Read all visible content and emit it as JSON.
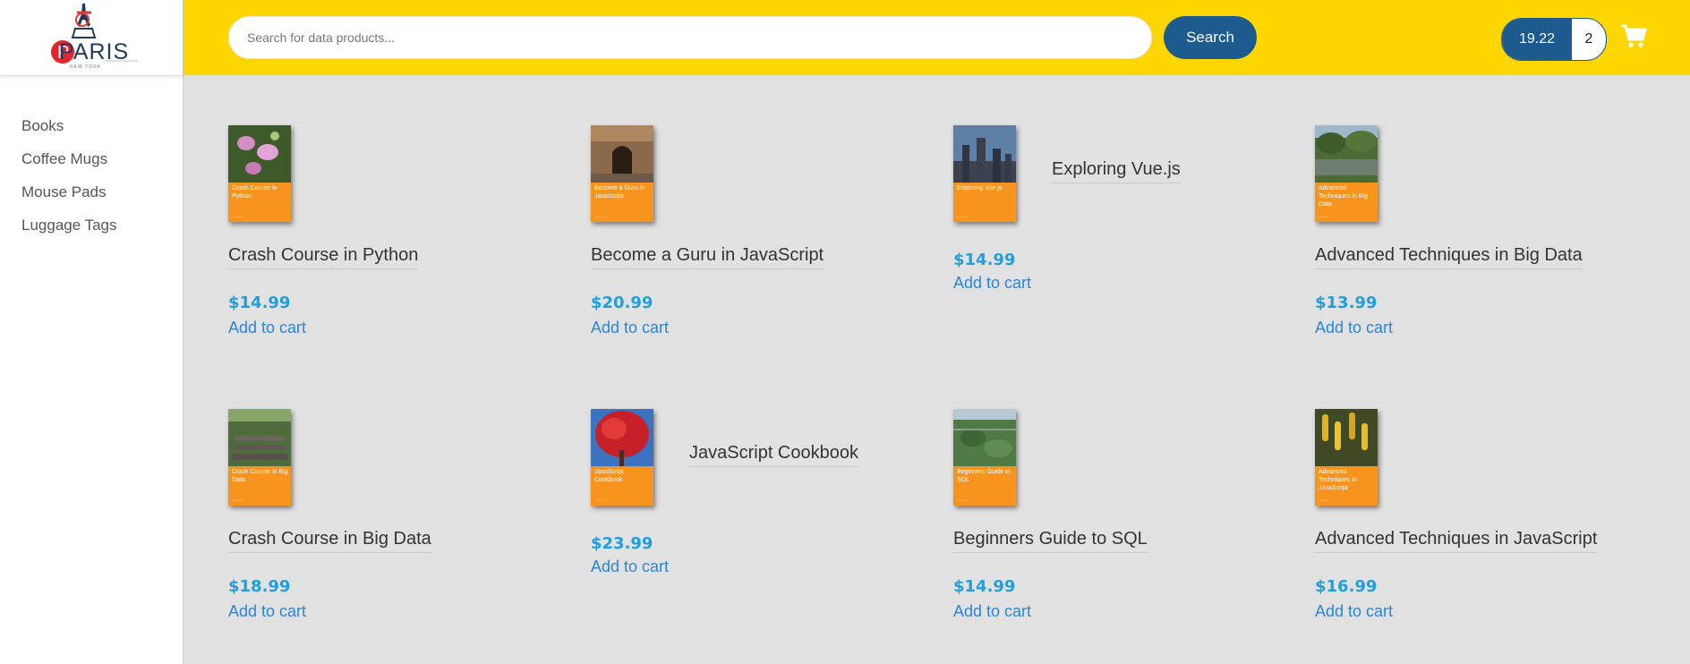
{
  "logo": {
    "brand": "PARIS",
    "tagline": "NEW YORK"
  },
  "sidebar": {
    "items": [
      {
        "label": "Books"
      },
      {
        "label": "Coffee Mugs"
      },
      {
        "label": "Mouse Pads"
      },
      {
        "label": "Luggage Tags"
      }
    ]
  },
  "search": {
    "placeholder": "Search for data products...",
    "value": "",
    "button_label": "Search"
  },
  "cart": {
    "total": "19.22",
    "count": "2",
    "icon": "cart-icon"
  },
  "colors": {
    "topbar": "#ffd600",
    "primary": "#1d5a8e",
    "price": "#1ea0df",
    "link": "#2b86d6",
    "cover": "#f7941d",
    "main_bg": "#e1e1e1"
  },
  "products": [
    {
      "title": "Crash Course in Python",
      "price": "$14.99",
      "add_label": "Add to cart",
      "cover_title": "Crash Course in Python",
      "cover_image": "pink-orchid-flowers"
    },
    {
      "title": "Become a Guru in JavaScript",
      "price": "$20.99",
      "add_label": "Add to cart",
      "cover_title": "Become a Guru in JavaScript",
      "cover_image": "stone-archway-door"
    },
    {
      "title": "Exploring Vue.js",
      "price": "$14.99",
      "add_label": "Add to cart",
      "cover_title": "Exploring Vue.js",
      "cover_image": "city-skyline-dusk"
    },
    {
      "title": "Advanced Techniques in Big Data",
      "price": "$13.99",
      "add_label": "Add to cart",
      "cover_title": "Advanced Techniques in Big Data",
      "cover_image": "pond-and-trees"
    },
    {
      "title": "Crash Course in Big Data",
      "price": "$18.99",
      "add_label": "Add to cart",
      "cover_title": "Crash Course in Big Data",
      "cover_image": "stone-steps-forest"
    },
    {
      "title": "JavaScript Cookbook",
      "price": "$23.99",
      "add_label": "Add to cart",
      "cover_title": "JavaScript Cookbook",
      "cover_image": "red-maple-tree"
    },
    {
      "title": "Beginners Guide to SQL",
      "price": "$14.99",
      "add_label": "Add to cart",
      "cover_title": "Beginners Guide to SQL",
      "cover_image": "aerial-green-park"
    },
    {
      "title": "Advanced Techniques in JavaScript",
      "price": "$16.99",
      "add_label": "Add to cart",
      "cover_title": "Advanced Techniques in JavaScript",
      "cover_image": "yellow-tubular-flowers"
    }
  ]
}
